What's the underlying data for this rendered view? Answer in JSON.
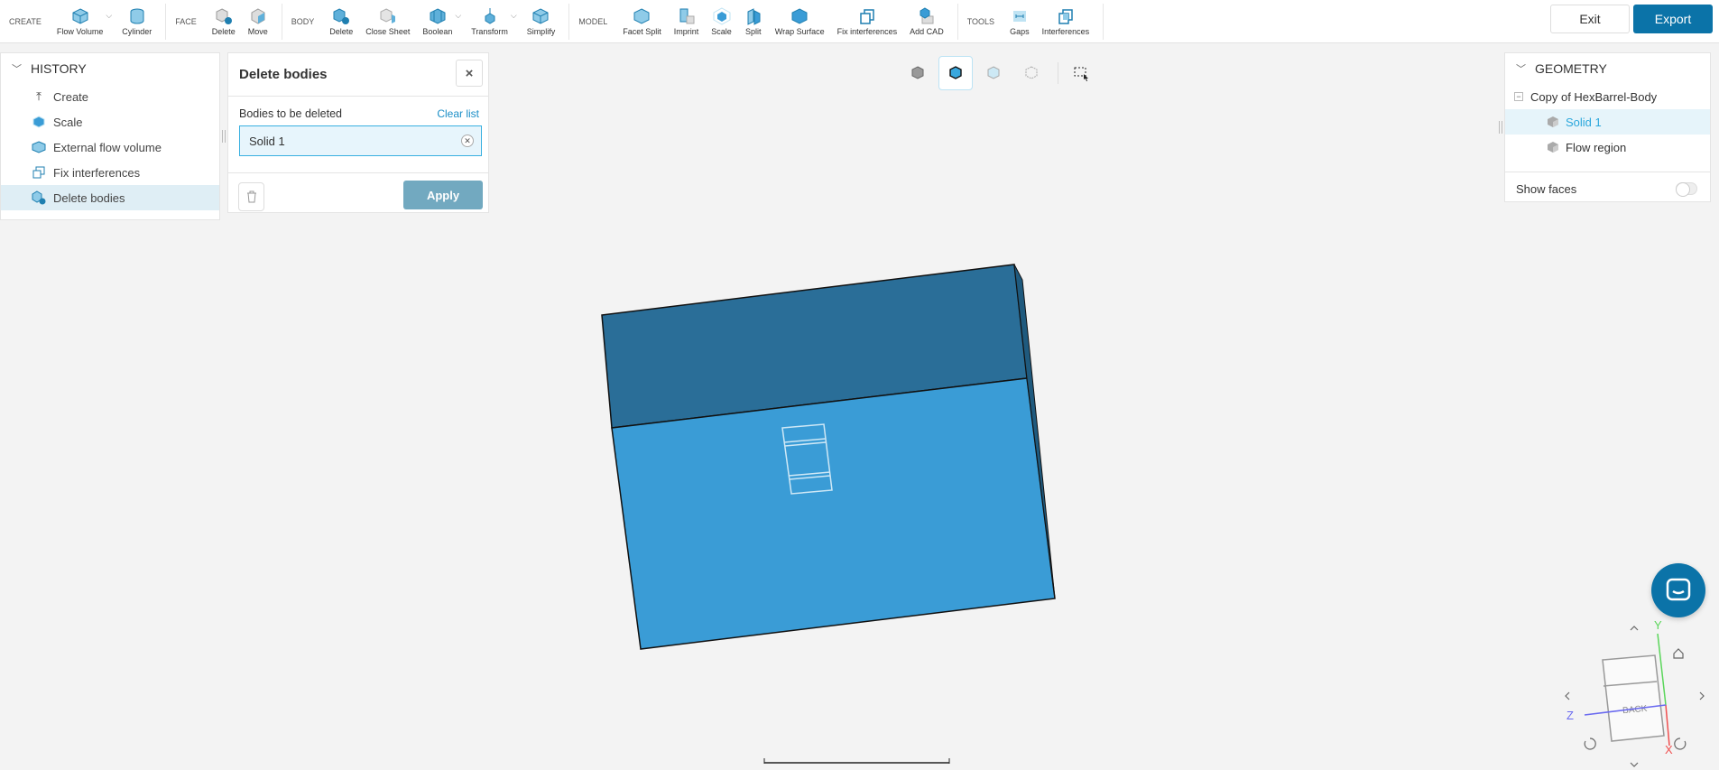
{
  "toolbar": {
    "groups": [
      {
        "label": "CREATE",
        "tools": [
          "Flow Volume",
          "Cylinder"
        ]
      },
      {
        "label": "FACE",
        "tools": [
          "Delete",
          "Move"
        ]
      },
      {
        "label": "BODY",
        "tools": [
          "Delete",
          "Close Sheet",
          "Boolean",
          "Transform",
          "Simplify"
        ]
      },
      {
        "label": "MODEL",
        "tools": [
          "Facet Split",
          "Imprint",
          "Scale",
          "Split",
          "Wrap Surface",
          "Fix interferences",
          "Add CAD"
        ]
      },
      {
        "label": "TOOLS",
        "tools": [
          "Gaps",
          "Interferences"
        ]
      }
    ],
    "exit": "Exit",
    "export": "Export",
    "accent": "#0b73a8"
  },
  "history": {
    "title": "HISTORY",
    "items": [
      "Create",
      "Scale",
      "External flow volume",
      "Fix interferences",
      "Delete bodies"
    ],
    "selected": "Delete bodies"
  },
  "delete_panel": {
    "title": "Delete bodies",
    "field_label": "Bodies to be deleted",
    "clear": "Clear list",
    "value": "Solid 1",
    "apply": "Apply",
    "close": "×"
  },
  "geometry": {
    "title": "GEOMETRY",
    "root": "Copy of HexBarrel-Body",
    "children": [
      "Solid 1",
      "Flow region"
    ],
    "selected": "Solid 1",
    "show_faces": "Show faces",
    "show_faces_on": false
  },
  "viewcube": {
    "face_label": "BACK",
    "axes": [
      "X",
      "Y",
      "Z"
    ]
  },
  "model_colors": {
    "top": "#2a6e98",
    "front": "#3a9cd6"
  }
}
